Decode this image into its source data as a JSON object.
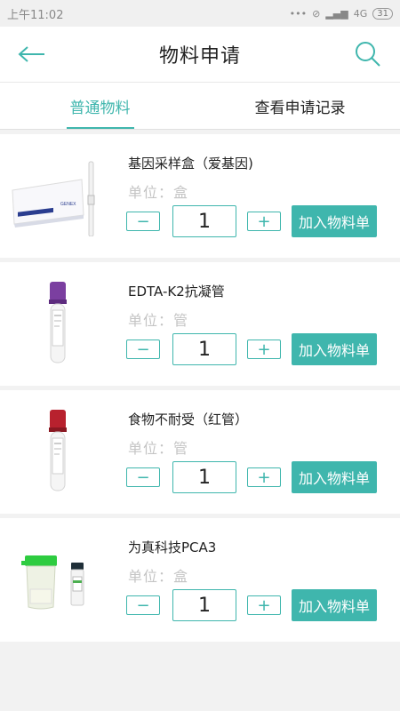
{
  "status": {
    "time": "上午11:02",
    "signal": "4G",
    "battery": "31"
  },
  "header": {
    "title": "物料申请"
  },
  "tabs": [
    {
      "label": "普通物料",
      "active": true
    },
    {
      "label": "查看申请记录",
      "active": false
    }
  ],
  "items": [
    {
      "name": "基因采样盒（爱基因)",
      "unit": "单位：盒",
      "qty": "1",
      "add_label": "加入物料单",
      "image": "gene-sampling-box"
    },
    {
      "name": "EDTA-K2抗凝管",
      "unit": "单位：管",
      "qty": "1",
      "add_label": "加入物料单",
      "image": "purple-cap-tube"
    },
    {
      "name": "食物不耐受（红管）",
      "unit": "单位：管",
      "qty": "1",
      "add_label": "加入物料单",
      "image": "red-cap-tube"
    },
    {
      "name": "为真科技PCA3",
      "unit": "单位：盒",
      "qty": "1",
      "add_label": "加入物料单",
      "image": "urine-cup-and-vial"
    }
  ],
  "colors": {
    "accent": "#3fb6ad",
    "purple_cap": "#7b3fa0",
    "red_cap": "#b8212e",
    "green_cap": "#2ecc40"
  }
}
